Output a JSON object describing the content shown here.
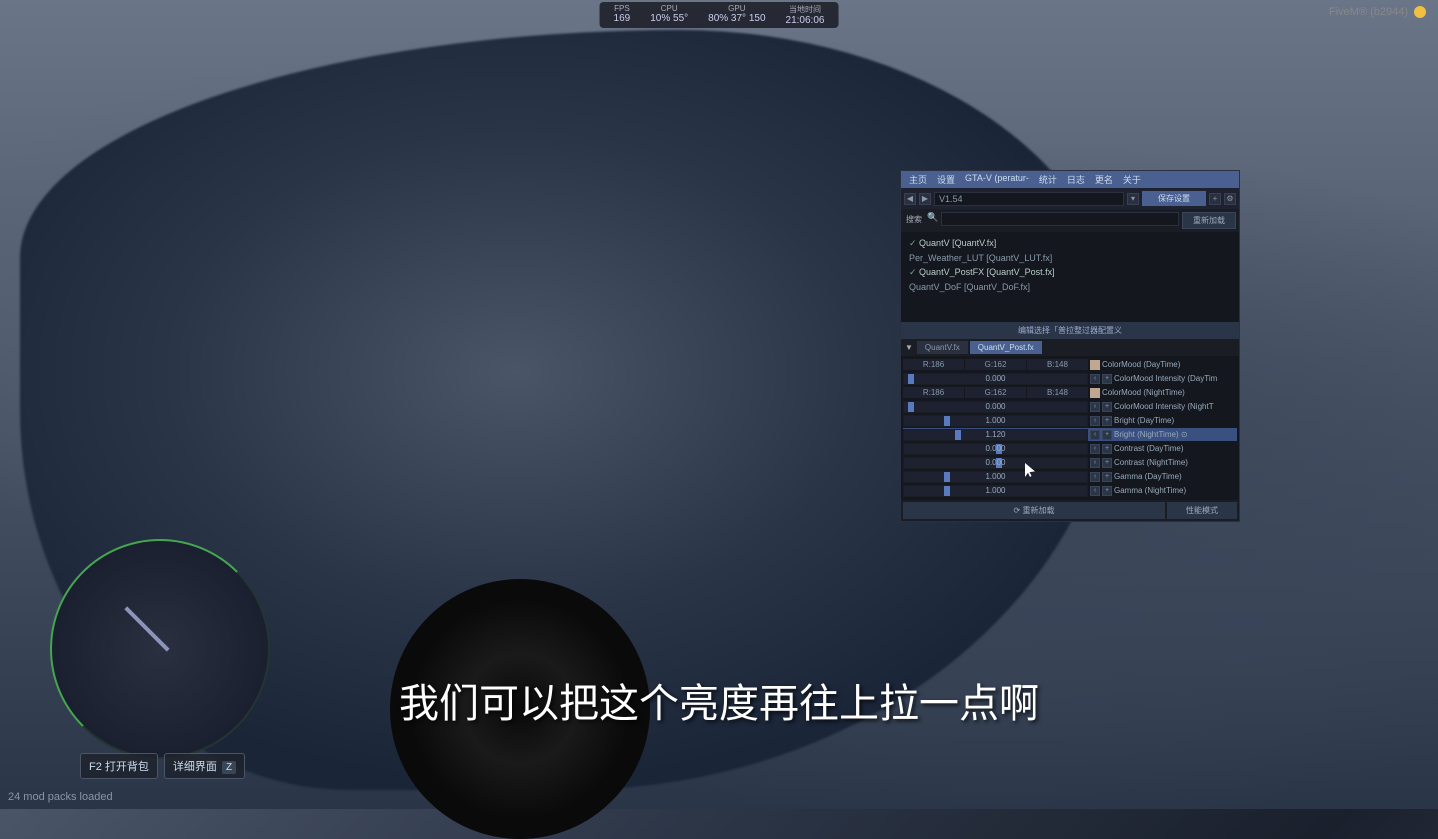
{
  "topbar": {
    "fps_label": "FPS",
    "fps_value": "169",
    "cpu_label": "CPU",
    "cpu_vals": "10%  55°",
    "gpu_label": "GPU",
    "gpu_vals": "80%  37°  150",
    "time_label": "当地时间",
    "time_value": "21:06:06"
  },
  "topright": {
    "text": "FiveM® (b2944)"
  },
  "hints": {
    "bag": "F2 打开背包",
    "detail": "详细界面",
    "detail_key": "Z"
  },
  "status": "24 mod packs loaded",
  "subtitle": "我们可以把这个亮度再往上拉一点啊",
  "panel": {
    "menu": [
      "主页",
      "设置",
      "GTA-V (peratur-",
      "统计",
      "日志",
      "更名",
      "关于"
    ],
    "preset": "V1.54",
    "save_btn": "保存设置",
    "search_label": "搜索",
    "search_btn": "重新加载",
    "effects": [
      {
        "name": "QuantV [QuantV.fx]",
        "checked": true
      },
      {
        "name": "Per_Weather_LUT [QuantV_LUT.fx]",
        "checked": false
      },
      {
        "name": "QuantV_PostFX [QuantV_Post.fx]",
        "checked": true
      },
      {
        "name": "QuantV_DoF [QuantV_DoF.fx]",
        "checked": false
      }
    ],
    "section_header": "编辑选择「普拉整过器配置义",
    "tabs": [
      {
        "label": "QuantV.fx",
        "active": false
      },
      {
        "label": "QuantV_Post.fx",
        "active": true
      }
    ],
    "params": [
      {
        "type": "rgb",
        "r": "R:186",
        "g": "G:162",
        "b": "B:148",
        "label": "ColorMood (DayTime)",
        "swatch": "#c0a890"
      },
      {
        "type": "slider",
        "value": "0.000",
        "pos": 2,
        "label": "ColorMood Intensity (DayTim"
      },
      {
        "type": "rgb",
        "r": "R:186",
        "g": "G:162",
        "b": "B:148",
        "label": "ColorMood (NightTime)",
        "swatch": "#c0a890"
      },
      {
        "type": "slider",
        "value": "0.000",
        "pos": 2,
        "label": "ColorMood Intensity (NightT"
      },
      {
        "type": "slider",
        "value": "1.000",
        "pos": 22,
        "label": "Bright (DayTime)"
      },
      {
        "type": "slider",
        "value": "1.120",
        "pos": 28,
        "label": "Bright (NightTime)  ⊙",
        "selected": true
      },
      {
        "type": "slider",
        "value": "0.000",
        "pos": 50,
        "label": "Contrast (DayTime)"
      },
      {
        "type": "slider",
        "value": "0.000",
        "pos": 50,
        "label": "Contrast (NightTime)"
      },
      {
        "type": "slider",
        "value": "1.000",
        "pos": 22,
        "label": "Gamma (DayTime)"
      },
      {
        "type": "slider",
        "value": "1.000",
        "pos": 22,
        "label": "Gamma (NightTime)"
      }
    ],
    "footer_reload": "⟳ 重新加载",
    "footer_mode": "性能模式"
  }
}
